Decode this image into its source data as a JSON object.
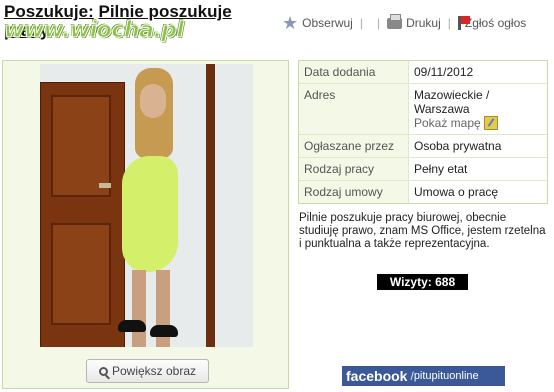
{
  "page": {
    "title": "Poszukuje: Pilnie poszukuje pracy",
    "title_prefix": "Poszukuje:",
    "title_rest": "Pilnie poszukuje pracy",
    "watermark": "www.wiocha.pl"
  },
  "actions": [
    {
      "label": "Obserwuj",
      "icon": "star-icon"
    },
    {
      "label": "Drukuj",
      "icon": "printer-icon"
    },
    {
      "label": "Zgłoś ogłos",
      "icon": "flag-icon"
    }
  ],
  "gallery": {
    "zoom_label": "Powiększ obraz"
  },
  "details": [
    {
      "label": "Data dodania",
      "value": "09/11/2012"
    },
    {
      "label": "Adres",
      "value": "Mazowieckie / Warszawa",
      "link": "Pokaż mapę"
    },
    {
      "label": "Ogłaszane przez",
      "value": "Osoba prywatna"
    },
    {
      "label": "Rodzaj pracy",
      "value": "Pełny etat"
    },
    {
      "label": "Rodzaj umowy",
      "value": "Umowa o pracę"
    }
  ],
  "description": "Pilnie poszukuje pracy biurowej, obecnie studiuję prawo, znam MS Office, jestem rzetelna i punktualna a także reprezentacyjna.",
  "visits": "Wizyty: 688",
  "facebook": {
    "brand": "facebook",
    "slash": "/",
    "page": "pitupituonline"
  },
  "colors": {
    "panel_bg": "#f4f8e6",
    "panel_border": "#c9d9a5",
    "facebook_blue": "#3b5998",
    "watermark_green": "#8bc34a",
    "report_flag": "#d9262a"
  }
}
